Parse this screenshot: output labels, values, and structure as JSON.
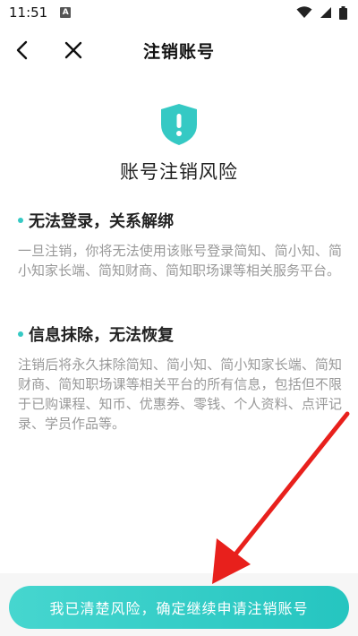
{
  "status_bar": {
    "time": "11:51",
    "notification_badge": "A",
    "icons": [
      "wifi-icon",
      "signal-icon",
      "battery-icon"
    ]
  },
  "nav": {
    "title": "注销账号",
    "icons": [
      "back-arrow-icon",
      "close-icon"
    ]
  },
  "hero": {
    "icon": "shield-alert-icon",
    "title": "账号注销风险"
  },
  "sections": [
    {
      "title": "无法登录，关系解绑",
      "body": "一旦注销，你将无法使用该账号登录简知、简小知、简小知家长端、简知财商、简知职场课等相关服务平台。"
    },
    {
      "title": "信息抹除，无法恢复",
      "body": "注销后将永久抹除简知、简小知、简小知家长端、简知财商、简知职场课等相关平台的所有信息，包括但不限于已购课程、知币、优惠券、零钱、个人资料、点评记录、学员作品等。"
    }
  ],
  "confirm_button": {
    "label": "我已清楚风险，确定继续申请注销账号"
  },
  "colors": {
    "accent": "#35c9c4",
    "button_gradient_start": "#46d6cf",
    "button_gradient_end": "#25c5c0",
    "annotation_arrow": "#e8201c",
    "body_text": "#999999"
  }
}
